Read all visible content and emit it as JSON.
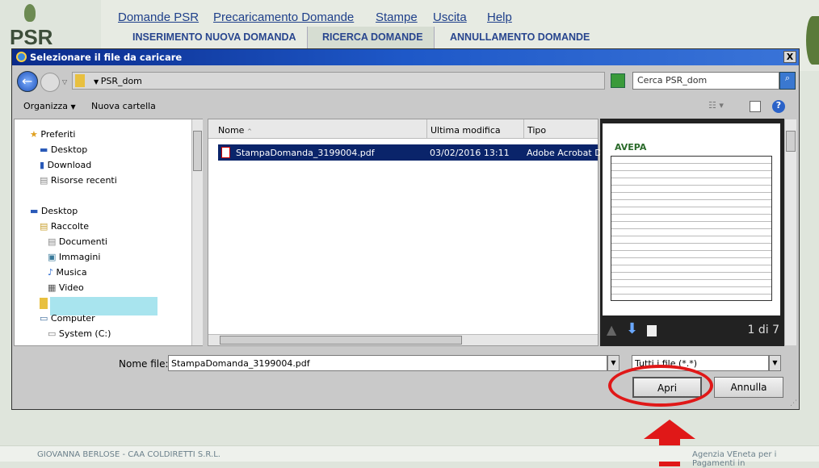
{
  "site": {
    "logo_text": "PSR",
    "nav": [
      "Domande PSR",
      "Precaricamento Domande",
      "Stampe",
      "Uscita",
      "Help"
    ],
    "subnav": [
      "INSERIMENTO NUOVA DOMANDA",
      "RICERCA DOMANDE",
      "ANNULLAMENTO DOMANDE"
    ],
    "footer_left": "GIOVANNA BERLOSE - CAA COLDIRETTI S.R.L.",
    "footer_right": "Agenzia VEneta per i Pagamenti in"
  },
  "dialog": {
    "title": "Selezionare il file da caricare",
    "close": "X",
    "path": "PSR_dom",
    "search_placeholder": "Cerca PSR_dom",
    "organize": "Organizza",
    "new_folder": "Nuova cartella",
    "sidebar": [
      {
        "label": "Preferiti",
        "icon": "star-icon"
      },
      {
        "label": "Desktop",
        "icon": "desktop-icon"
      },
      {
        "label": "Download",
        "icon": "download-folder-icon"
      },
      {
        "label": "Risorse recenti",
        "icon": "recent-icon"
      },
      {
        "label": "Desktop",
        "icon": "desktop-icon"
      },
      {
        "label": "Raccolte",
        "icon": "libraries-icon"
      },
      {
        "label": "Documenti",
        "icon": "documents-icon"
      },
      {
        "label": "Immagini",
        "icon": "pictures-icon"
      },
      {
        "label": "Musica",
        "icon": "music-icon"
      },
      {
        "label": "Video",
        "icon": "video-icon"
      },
      {
        "label": "Computer",
        "icon": "computer-icon"
      },
      {
        "label": "System (C:)",
        "icon": "drive-icon"
      }
    ],
    "columns": [
      "Nome",
      "Ultima modifica",
      "Tipo"
    ],
    "files": [
      {
        "name": "StampaDomanda_3199004.pdf",
        "modified": "03/02/2016 13:11",
        "type": "Adobe Acrobat Do"
      }
    ],
    "preview_page": "1 di 7",
    "preview_brand": "AVEPA",
    "filename_label": "Nome file:",
    "filename_value": "StampaDomanda_3199004.pdf",
    "filter": "Tutti i file (*.*)",
    "open": "Apri",
    "cancel": "Annulla"
  },
  "colors": {
    "annotation": "#e01818",
    "selection": "#0a246a"
  }
}
